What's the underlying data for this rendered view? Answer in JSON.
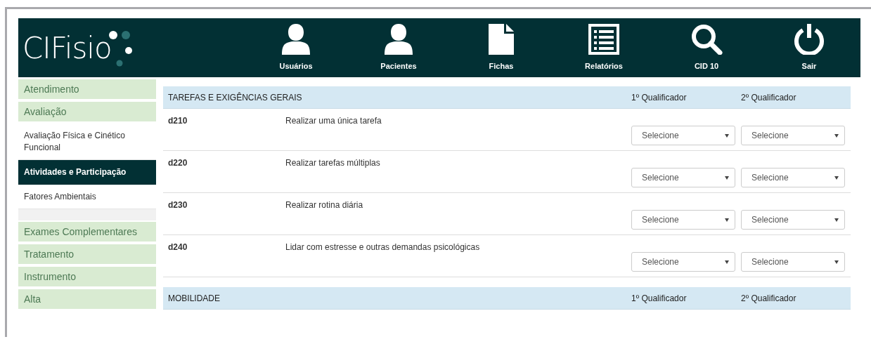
{
  "header": {
    "logo": "CIFisio",
    "nav": [
      {
        "label": "Usuários",
        "kind": "user"
      },
      {
        "label": "Pacientes",
        "kind": "user"
      },
      {
        "label": "Fichas",
        "kind": "document"
      },
      {
        "label": "Relatórios",
        "kind": "list"
      },
      {
        "label": "CID 10",
        "kind": "search"
      },
      {
        "label": "Sair",
        "kind": "power"
      }
    ]
  },
  "sidebar": {
    "items": [
      {
        "label": "Atendimento",
        "kind": "section",
        "selected": false
      },
      {
        "label": "Avaliação",
        "kind": "section",
        "selected": false
      },
      {
        "label": "Avaliação Física e Cinético Funcional",
        "kind": "subitem",
        "selected": false
      },
      {
        "label": "Atividades e Participação",
        "kind": "subitem",
        "selected": true
      },
      {
        "label": "Fatores Ambientais",
        "kind": "subitem",
        "selected": false
      },
      {
        "label": "Exames Complementares",
        "kind": "section",
        "selected": false
      },
      {
        "label": "Tratamento",
        "kind": "section",
        "selected": false
      },
      {
        "label": "Instrumento",
        "kind": "section",
        "selected": false
      },
      {
        "label": "Alta",
        "kind": "section",
        "selected": false
      }
    ]
  },
  "sections": [
    {
      "title": "TAREFAS E EXIGÊNCIAS GERAIS",
      "columns": [
        "1º Qualificador",
        "2º Qualificador"
      ],
      "rows": [
        {
          "code": "d210",
          "description": "Realizar uma única tarefa",
          "qualifiers": [
            "Selecione",
            "Selecione"
          ]
        },
        {
          "code": "d220",
          "description": "Realizar tarefas múltiplas",
          "qualifiers": [
            "Selecione",
            "Selecione"
          ]
        },
        {
          "code": "d230",
          "description": "Realizar rotina diária",
          "qualifiers": [
            "Selecione",
            "Selecione"
          ]
        },
        {
          "code": "d240",
          "description": "Lidar com estresse e outras demandas psicológicas",
          "qualifiers": [
            "Selecione",
            "Selecione"
          ]
        }
      ]
    },
    {
      "title": "MOBILIDADE",
      "columns": [
        "1º Qualificador",
        "2º Qualificador"
      ]
    }
  ]
}
